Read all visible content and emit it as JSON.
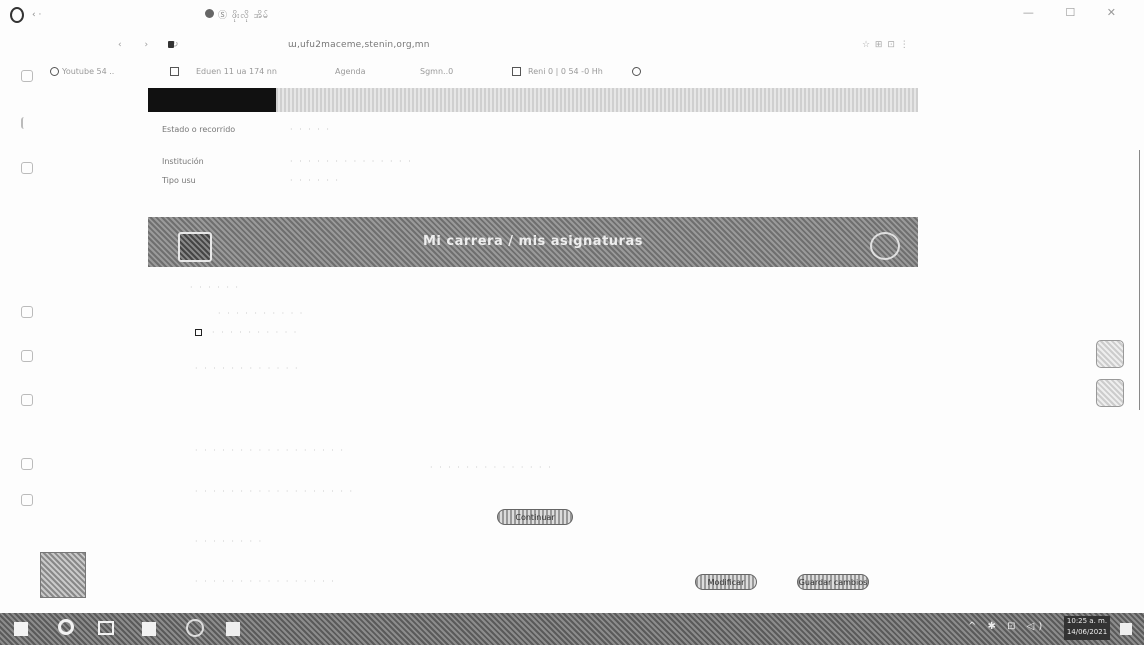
{
  "browser": {
    "tab_title": "Ⓢ ဖိုးလို အိမ်",
    "url": "ա,ufu2maceme,stenin,org,mn",
    "window_controls": "—  ☐  ✕",
    "nav_controls": "‹  ›  ↻",
    "addr_right": "☆ ⊞ ⊡ ⋮",
    "bookmarks": [
      "Youtube 54 ..",
      "Eduen 11 ua 174 nn",
      "Agenda",
      "Sgmn..0",
      "Reni 0 | 0 54 -0 Hh"
    ]
  },
  "page": {
    "rows": [
      {
        "label": "Estado o recorrido",
        "value": "· · · · ·"
      },
      {
        "label": "Institución",
        "value": "· · · · · · · · · · · · · ·"
      },
      {
        "label": "Tipo usu",
        "value": "· · · · · ·"
      }
    ],
    "banner": {
      "title": "Mi carrera / mis asignaturas"
    },
    "sub_lines": [
      "· · · · · ·",
      "· · · · · · · · · ·",
      "· · · · · · · · · ·"
    ],
    "mid_lines": [
      "· · · · · · · · · · · ·",
      "· · · · · · · · · · · · · · · · ·",
      "· · · · · · · · · · · · · ·",
      "· · · · · · · · · · · · · · · · · ·",
      "· · · · · · · ·",
      "· · · · · · · · · · · · · · · ·"
    ],
    "pill_center": "Continuar",
    "pill_left": "Modificar",
    "pill_right": "Guardar cambios"
  },
  "taskbar": {
    "time": "10:25 a. m.",
    "date": "14/06/2021",
    "tray": "^ ✱ ⊡ ◁)"
  }
}
